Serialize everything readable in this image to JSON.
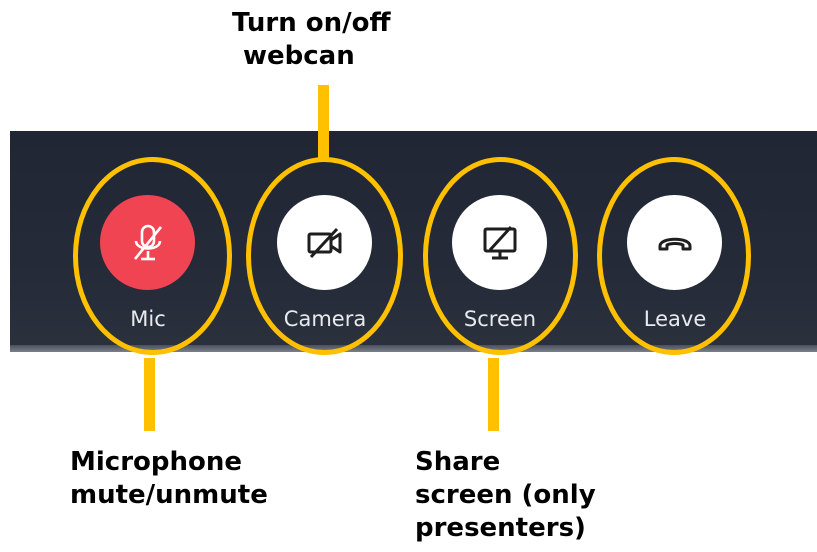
{
  "toolbar": {
    "buttons": [
      {
        "id": "mic",
        "label": "Mic",
        "icon": "mic-off-icon",
        "state": "muted",
        "color": "#f04452"
      },
      {
        "id": "camera",
        "label": "Camera",
        "icon": "camera-off-icon",
        "state": "off",
        "color": "#ffffff"
      },
      {
        "id": "screen",
        "label": "Screen",
        "icon": "screen-share-off-icon",
        "state": "off",
        "color": "#ffffff"
      },
      {
        "id": "leave",
        "label": "Leave",
        "icon": "hang-up-icon",
        "color": "#ffffff"
      }
    ]
  },
  "annotations": {
    "highlight_color": "#ffc000",
    "camera_callout": [
      "Turn on/off",
      "webcan"
    ],
    "mic_callout": [
      "Microphone",
      "mute/unmute"
    ],
    "screen_callout": [
      "Share",
      "screen (only",
      "presenters)"
    ]
  }
}
